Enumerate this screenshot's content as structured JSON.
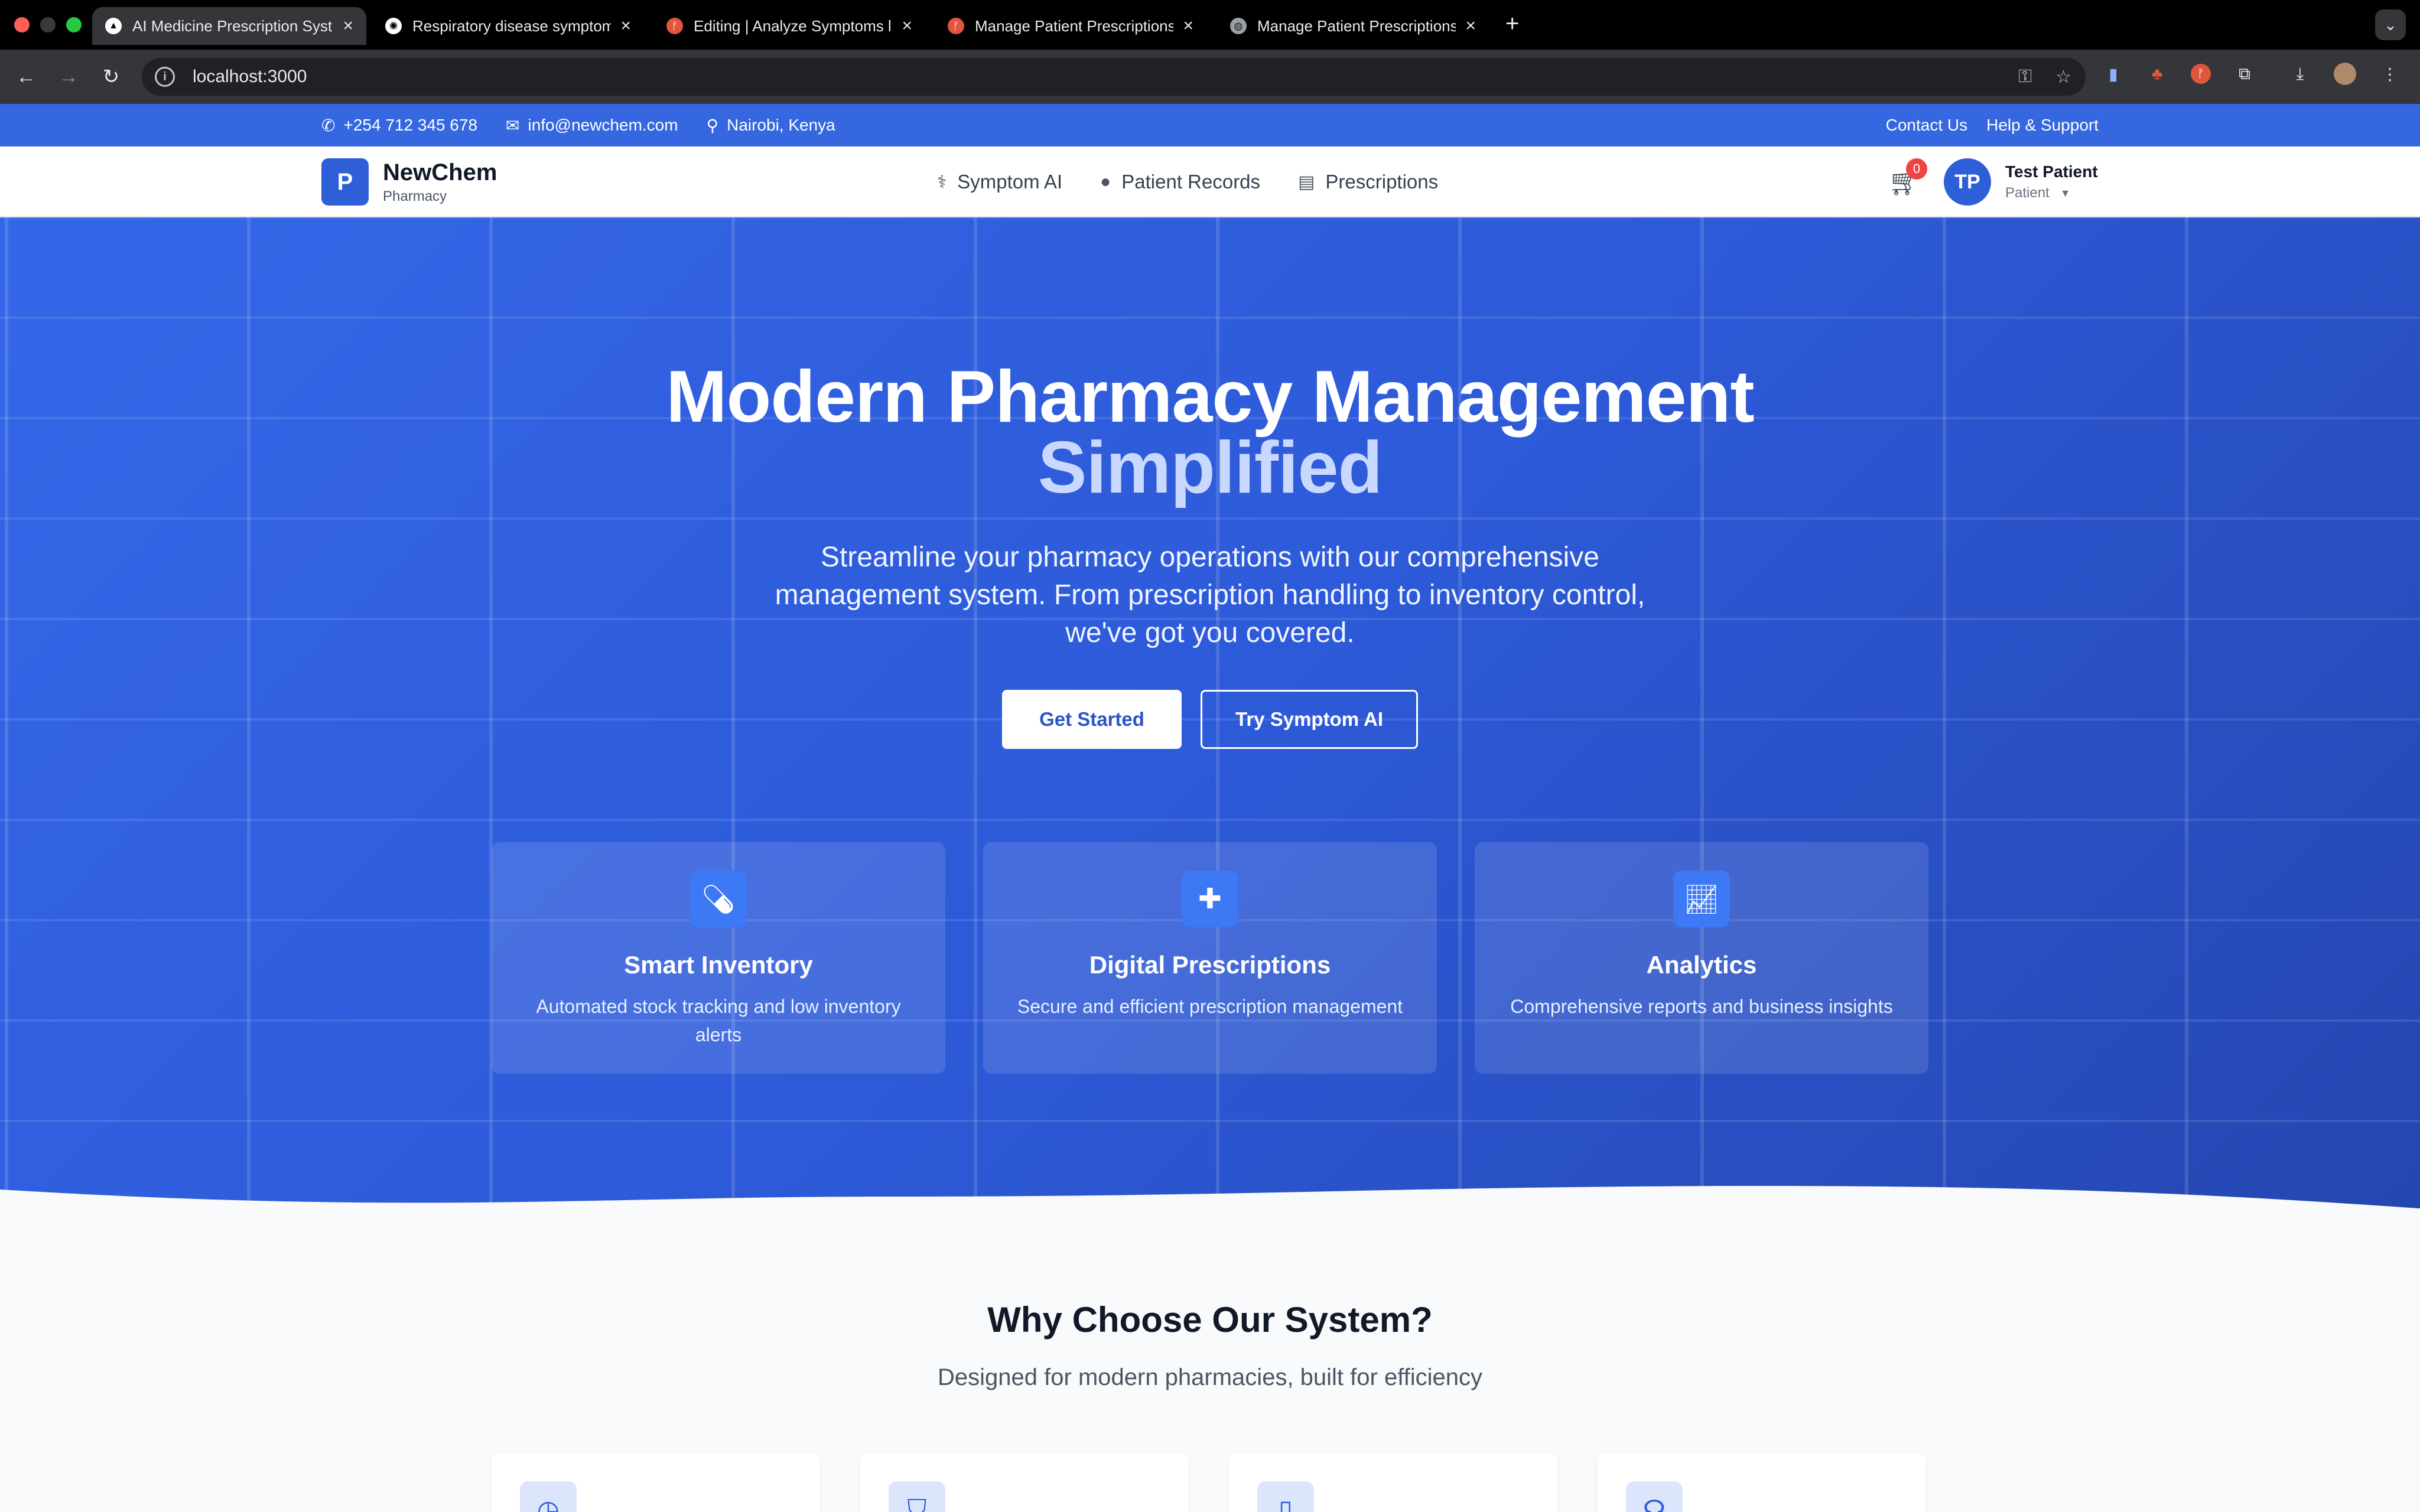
{
  "browser": {
    "tabs": [
      {
        "title": "AI Medicine Prescription Syst",
        "favicon": "triangle-logo-icon",
        "active": true
      },
      {
        "title": "Respiratory disease symptom",
        "favicon": "openai-icon",
        "active": false
      },
      {
        "title": "Editing | Analyze Symptoms li",
        "favicon": "orange-app-icon",
        "active": false
      },
      {
        "title": "Manage Patient Prescriptions",
        "favicon": "orange-app-icon",
        "active": false
      },
      {
        "title": "Manage Patient Prescriptions",
        "favicon": "globe-icon",
        "active": false
      }
    ],
    "url": "localhost:3000"
  },
  "infobar": {
    "phone": "+254 712 345 678",
    "email": "info@newchem.com",
    "location": "Nairobi, Kenya",
    "contact": "Contact Us",
    "help": "Help & Support"
  },
  "nav": {
    "logo_letter": "P",
    "brand": "NewChem",
    "brand_sub": "Pharmacy",
    "links": [
      {
        "label": "Symptom AI",
        "icon": "user-doctor-icon"
      },
      {
        "label": "Patient Records",
        "icon": "user-icon"
      },
      {
        "label": "Prescriptions",
        "icon": "file-prescription-icon"
      }
    ],
    "cart_count": "0",
    "user_initials": "TP",
    "user_name": "Test Patient",
    "user_role": "Patient"
  },
  "hero": {
    "title_line1": "Modern Pharmacy Management",
    "title_line2": "Simplified",
    "subtitle": "Streamline your pharmacy operations with our comprehensive management system. From prescription handling to inventory control, we've got you covered.",
    "primary_button": "Get Started",
    "secondary_button": "Try Symptom AI",
    "features": [
      {
        "icon": "pills-icon",
        "title": "Smart Inventory",
        "desc": "Automated stock tracking and low inventory alerts"
      },
      {
        "icon": "file-medical-icon",
        "title": "Digital Prescriptions",
        "desc": "Secure and efficient prescription management"
      },
      {
        "icon": "chart-line-icon",
        "title": "Analytics",
        "desc": "Comprehensive reports and business insights"
      }
    ]
  },
  "why": {
    "title": "Why Choose Our System?",
    "subtitle": "Designed for modern pharmacies, built for efficiency",
    "card_icons": [
      "clock-icon",
      "shield-icon",
      "mobile-icon",
      "headset-icon"
    ]
  },
  "colors": {
    "brand": "#2f5fd8",
    "infobar": "#3467e0",
    "badge": "#ef4444"
  }
}
